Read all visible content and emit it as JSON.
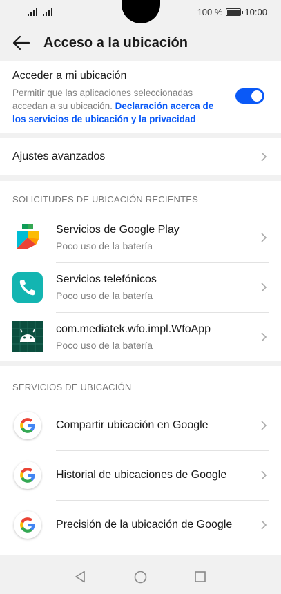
{
  "status_bar": {
    "battery": "100 %",
    "time": "10:00"
  },
  "header": {
    "title": "Acceso a la ubicación"
  },
  "location_access": {
    "title": "Acceder a mi ubicación",
    "desc_text": "Permitir que las aplicaciones seleccionadas accedan a su ubicación. ",
    "desc_link": "Declaración acerca de los servicios de ubicación y la privacidad",
    "toggle_on": true
  },
  "advanced": {
    "label": "Ajustes avanzados"
  },
  "recent_requests": {
    "section_title": "SOLICITUDES DE UBICACIÓN RECIENTES",
    "items": [
      {
        "name": "Servicios de Google Play",
        "sub": "Poco uso de la batería",
        "icon": "google-play-services-icon"
      },
      {
        "name": "Servicios telefónicos",
        "sub": "Poco uso de la batería",
        "icon": "phone-icon"
      },
      {
        "name": "com.mediatek.wfo.impl.WfoApp",
        "sub": "Poco uso de la batería",
        "icon": "android-icon"
      }
    ]
  },
  "location_services": {
    "section_title": "SERVICIOS DE UBICACIÓN",
    "items": [
      {
        "name": "Compartir ubicación en Google",
        "icon": "google-icon"
      },
      {
        "name": "Historial de ubicaciones de Google",
        "icon": "google-icon"
      },
      {
        "name": "Precisión de la ubicación de Google",
        "icon": "google-icon"
      }
    ]
  },
  "colors": {
    "accent": "#0a59f7",
    "link": "#0a59f7",
    "background": "#f1f1f1"
  }
}
